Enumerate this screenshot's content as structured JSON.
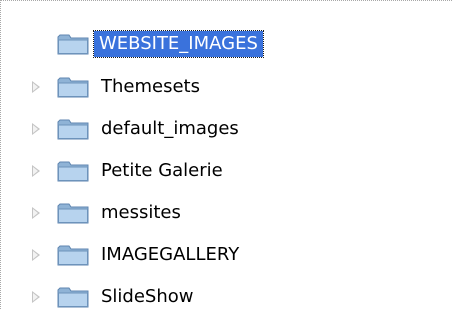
{
  "tree": {
    "nodes": [
      {
        "label": "WEBSITE_IMAGES",
        "icon": "folder-icon",
        "selected": true,
        "expandable": false
      },
      {
        "label": "Themesets",
        "icon": "folder-icon",
        "selected": false,
        "expandable": true
      },
      {
        "label": "default_images",
        "icon": "folder-icon",
        "selected": false,
        "expandable": true
      },
      {
        "label": "Petite Galerie",
        "icon": "folder-icon",
        "selected": false,
        "expandable": true
      },
      {
        "label": "messites",
        "icon": "folder-icon",
        "selected": false,
        "expandable": true
      },
      {
        "label": "IMAGEGALLERY",
        "icon": "folder-icon",
        "selected": false,
        "expandable": true
      },
      {
        "label": "SlideShow",
        "icon": "folder-icon",
        "selected": false,
        "expandable": true
      }
    ],
    "colors": {
      "selection_background": "#3a72dc",
      "selection_text": "#ffffff",
      "folder_fill": "#a9c9e6",
      "expander": "#c4c4c4"
    }
  }
}
